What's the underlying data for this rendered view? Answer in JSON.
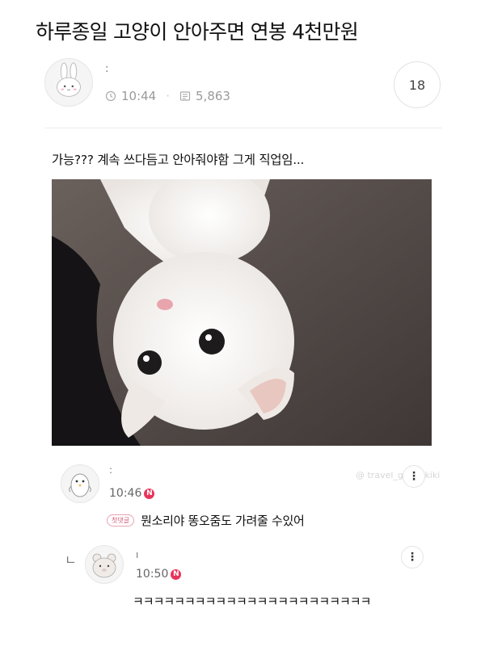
{
  "post": {
    "title": "하루종일 고양이 안아주면 연봉 4천만원",
    "author_name": ":",
    "time": "10:44",
    "views": "5,863",
    "comment_count": "18",
    "body": "가능??? 계속 쓰다듬고 안아줘야함 그게 직업임..."
  },
  "image": {
    "watermark": "@ travel_ghibli.kiki"
  },
  "comments": [
    {
      "name": ":",
      "time": "10:46",
      "new_marker": "N",
      "badge": "첫댓글",
      "text": "뭔소리야 똥오줌도 가려줄 수있어",
      "more": "⋮"
    },
    {
      "reply_marker": "ㄴ",
      "name": "ı",
      "time": "10:50",
      "new_marker": "N",
      "text": "ㅋㅋㅋㅋㅋㅋㅋㅋㅋㅋㅋㅋㅋㅋㅋㅋㅋㅋㅋㅋㅋㅋㅋ",
      "more": "⋮"
    }
  ],
  "icons": {
    "author_avatar": "bunny-avatar-icon",
    "clock": "clock-icon",
    "views": "views-icon",
    "comment1_avatar": "penguin-avatar-icon",
    "comment2_avatar": "bear-avatar-icon"
  },
  "colors": {
    "new_dot": "#e8345a",
    "badge": "#d55a79",
    "meta": "#9a9a9a"
  }
}
